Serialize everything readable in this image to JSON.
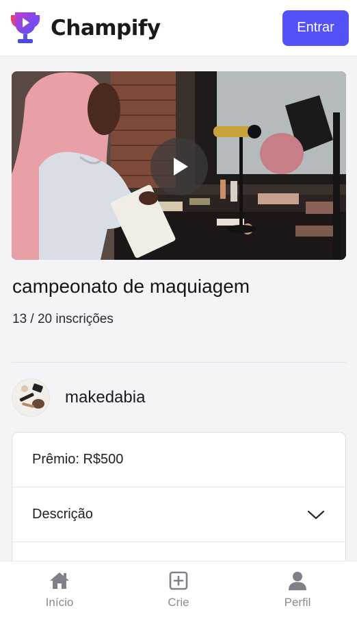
{
  "header": {
    "brand": "Champify",
    "login_label": "Entrar",
    "accent": "#5452f6",
    "logo_icon": "trophy-play-icon"
  },
  "contest": {
    "title": "campeonato de maquiagem",
    "subscriptions": "13 / 20 inscrições",
    "video_icon": "play-icon"
  },
  "creator": {
    "name": "makedabia",
    "avatar_icon": "makeup-brushes-avatar"
  },
  "details": {
    "prize": "Prêmio: R$500",
    "description_label": "Descrição",
    "description_icon": "chevron-down-icon"
  },
  "bottom_nav": {
    "items": [
      {
        "label": "Início",
        "icon": "home-icon"
      },
      {
        "label": "Crie",
        "icon": "plus-square-icon"
      },
      {
        "label": "Perfil",
        "icon": "user-icon"
      }
    ]
  }
}
